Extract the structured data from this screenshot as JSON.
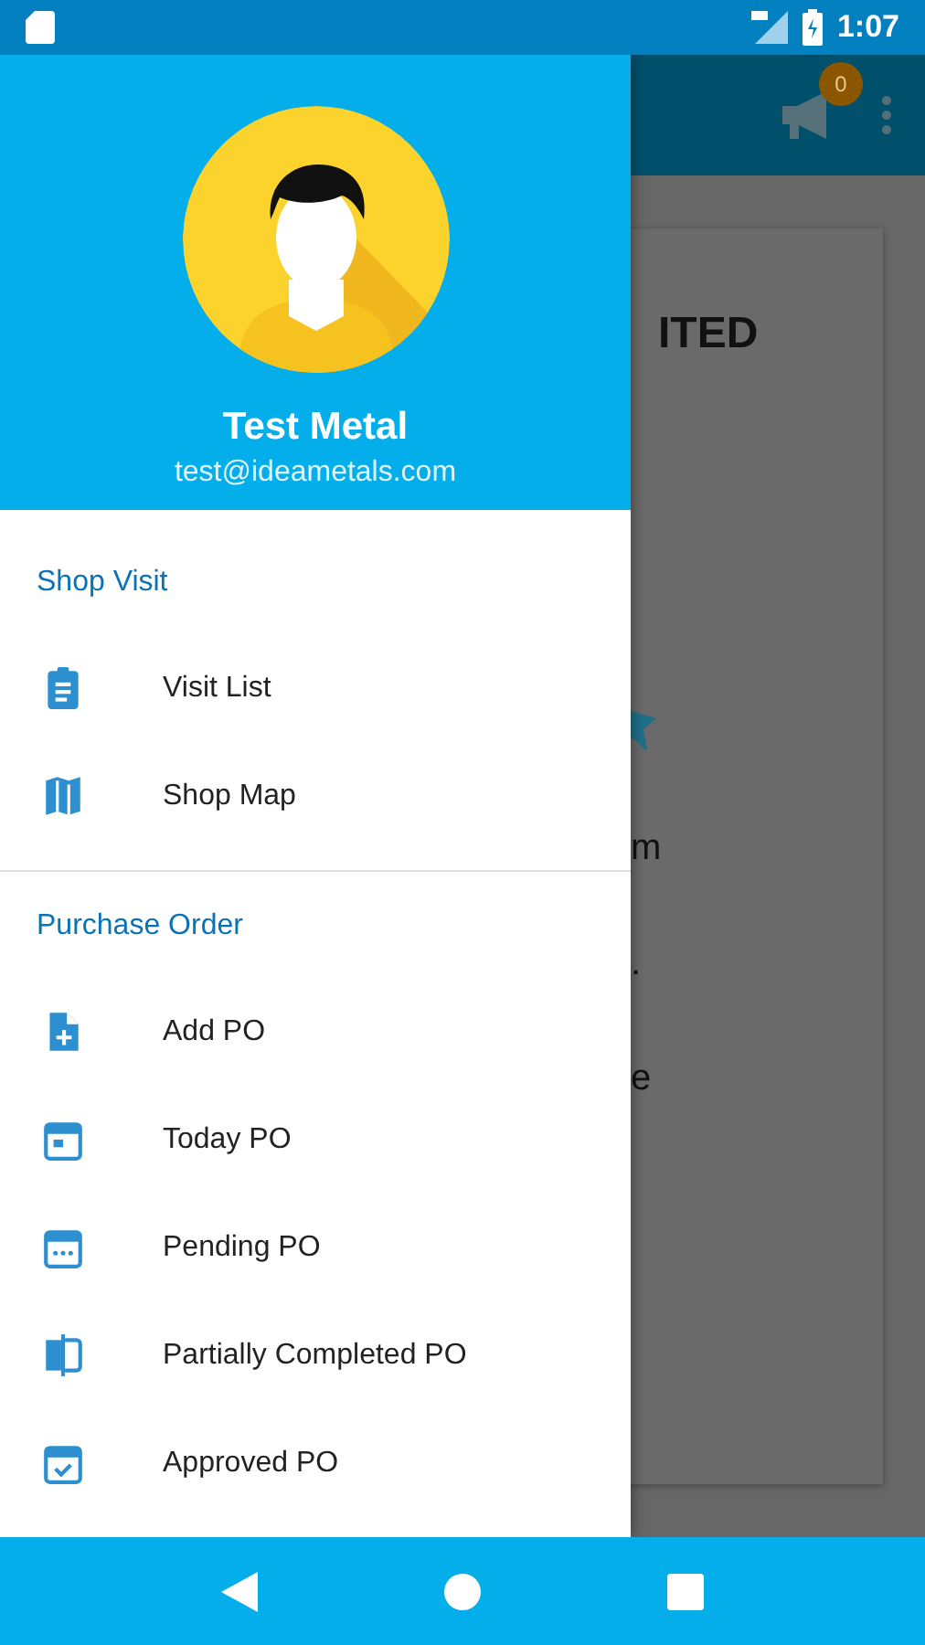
{
  "status_bar": {
    "time": "1:07"
  },
  "background_screen": {
    "notification_badge": "0",
    "card_texts": [
      {
        "kind": "title",
        "text": "ITED"
      },
      {
        "kind": "line",
        "text": "m"
      },
      {
        "kind": "line",
        "text": "."
      },
      {
        "kind": "line",
        "text": "e"
      }
    ]
  },
  "drawer": {
    "user_name": "Test Metal",
    "email": "test@ideametals.com",
    "sections": [
      {
        "title": "Shop Visit",
        "items": [
          {
            "label": "Visit List",
            "kind": "clipboard"
          },
          {
            "label": "Shop Map",
            "kind": "map"
          }
        ]
      },
      {
        "title": "Purchase Order",
        "items": [
          {
            "label": "Add PO",
            "kind": "add"
          },
          {
            "label": "Today PO",
            "kind": "today"
          },
          {
            "label": "Pending PO",
            "kind": "pending"
          },
          {
            "label": "Partially Completed PO",
            "kind": "partial"
          },
          {
            "label": "Approved PO",
            "kind": "approved"
          }
        ]
      }
    ]
  }
}
